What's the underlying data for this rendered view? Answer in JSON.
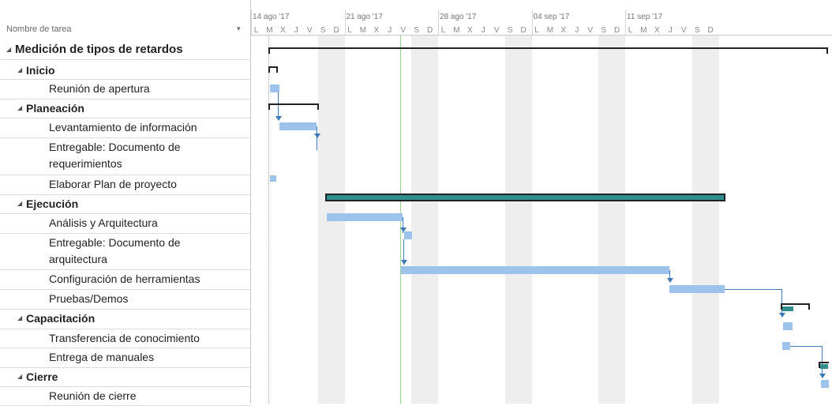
{
  "task_header": {
    "label": "Nombre de tarea",
    "dropdown_icon": "▾"
  },
  "timeline": {
    "weeks": [
      "14 ago '17",
      "21 ago '17",
      "28 ago '17",
      "04 sep '17",
      "11 sep '17"
    ],
    "day_letters": [
      "L",
      "M",
      "X",
      "J",
      "V",
      "S",
      "D"
    ]
  },
  "tasks": [
    {
      "label": "Medición de tipos de retardos",
      "type": "summary",
      "level": 0,
      "caret": "◢"
    },
    {
      "label": "Inicio",
      "type": "summary",
      "level": 1,
      "caret": "◢"
    },
    {
      "label": "Reunión de apertura",
      "type": "task",
      "level": 2
    },
    {
      "label": "Planeación",
      "type": "summary",
      "level": 1,
      "caret": "◢"
    },
    {
      "label": "Levantamiento de información",
      "type": "task",
      "level": 2
    },
    {
      "label": "Entregable: Documento de",
      "label2": "requerimientos",
      "type": "task",
      "level": 2,
      "double": true
    },
    {
      "label": "Elaborar Plan de proyecto",
      "type": "task",
      "level": 2
    },
    {
      "label": "Ejecución",
      "type": "summary",
      "level": 1,
      "caret": "◢"
    },
    {
      "label": "Análisis y Arquitectura",
      "type": "task",
      "level": 2
    },
    {
      "label": "Entregable: Documento de",
      "label2": "arquitectura",
      "type": "task",
      "level": 2,
      "double": true
    },
    {
      "label": "Configuración de herramientas",
      "type": "task",
      "level": 2
    },
    {
      "label": "Pruebas/Demos",
      "type": "task",
      "level": 2
    },
    {
      "label": "Capacitación",
      "type": "summary",
      "level": 1,
      "caret": "◢"
    },
    {
      "label": "Transferencia de conocimiento",
      "type": "task",
      "level": 2
    },
    {
      "label": "Entrega de manuales",
      "type": "task",
      "level": 2
    },
    {
      "label": "Cierre",
      "type": "summary",
      "level": 1,
      "caret": "◢"
    },
    {
      "label": "Reunión de cierre",
      "type": "task",
      "level": 2
    }
  ]
}
